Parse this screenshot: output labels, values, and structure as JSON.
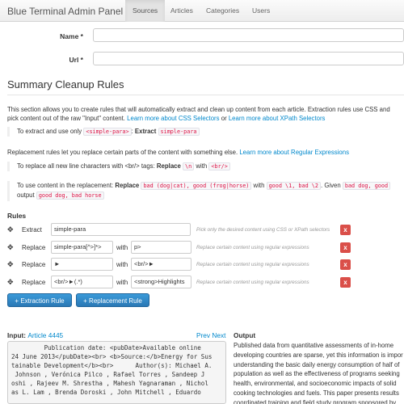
{
  "nav": {
    "brand": "Blue Terminal Admin Panel",
    "tabs": [
      {
        "label": "Sources",
        "active": true
      },
      {
        "label": "Articles",
        "active": false
      },
      {
        "label": "Categories",
        "active": false
      },
      {
        "label": "Users",
        "active": false
      }
    ]
  },
  "form": {
    "name_label": "Name *",
    "url_label": "Url *",
    "name_value": "",
    "url_value": ""
  },
  "summary": {
    "title": "Summary Cleanup Rules",
    "intro_line1": "This section allows you to create rules that will automatically extract and clean up content from each article. Extraction rules use CSS and",
    "intro_line2_pre": "pick content out of the raw \"Input\" content. ",
    "intro_link1": "Learn more about CSS Selectors",
    "intro_mid": " or ",
    "intro_link2": "Learn more about XPath Selectors",
    "extract_quote_pre": "To extract and use only ",
    "extract_code1": "<simple-para>",
    "extract_colon": ": ",
    "extract_bold": "Extract",
    "extract_code2": "simple-para",
    "replace_intro_pre": "Replacement rules let you replace certain parts of the content with something else. ",
    "replace_intro_link": "Learn more about Regular Expressions",
    "replace_quote_pre": "To replace all new line characters with <br/> tags: ",
    "replace_quote_bold": "Replace",
    "replace_quote_code1": "\\n",
    "replace_quote_with": " with ",
    "replace_quote_code2": "<br/>",
    "content_quote_pre": "To use content in the replacement: ",
    "content_quote_bold": "Replace",
    "content_quote_code1": "bad (dog|cat), good (frog|horse)",
    "content_quote_with": " with ",
    "content_quote_code2": "good \\1, bad \\2",
    "content_quote_given": ". Given ",
    "content_quote_code3": "bad dog, good",
    "content_quote_line2_pre": "output ",
    "content_quote_code4": "good dog, bad horse"
  },
  "rules": {
    "heading": "Rules",
    "with_label": "with",
    "delete_label": "x",
    "items": [
      {
        "type": "Extract",
        "value": "simple-para",
        "replacement": "",
        "help": "Pick only the desired content using CSS or XPath selectors"
      },
      {
        "type": "Replace",
        "value": "simple-para[^>]*>",
        "replacement": "p>",
        "help": "Replace certain content using regular expressions"
      },
      {
        "type": "Replace",
        "value": "►",
        "replacement": "<br/>►",
        "help": "Replace certain content using regular expressions"
      },
      {
        "type": "Replace",
        "value": "<br/>►(.*)",
        "replacement": "<strong>Highlights",
        "help": "Replace certain content using regular expressions"
      }
    ],
    "add_extraction": "+ Extraction Rule",
    "add_replacement": "+ Replacement Rule"
  },
  "io": {
    "input_label": "Input:",
    "input_link": "Article 4445",
    "prev": "Prev",
    "next": "Next",
    "output_label": "Output",
    "input_text": "         Publication date: <pubDate>Available online\n24 June 2013</pubDate><br> <b>Source:</b>Energy for Sus\ntainable Development</b><br>      Author(s): Michael A.\n Johnson , Verónica Pilco , Rafael Torres , Sandeep J\noshi , Rajeev M. Shrestha , Mahesh Yagnaraman , Nichol\nas L. Lam , Brenda Doroski , John Mitchell , Eduardo",
    "output_text": "Published data from quantitative assessments of in-home\ndeveloping countries are sparse, yet this information is impor\nunderstanding the basic daily energy consumption of half of\npopulation as well as the effectiveness of programs seeking\nhealth, environmental, and socioeconomic impacts of solid\ncooking technologies and fuels. This paper presents results\ncoordinated training and field study program sponsored by"
  },
  "colors": {
    "link": "#0088cc",
    "delete": "#da4f49",
    "primary_button": "#2a78b5"
  }
}
